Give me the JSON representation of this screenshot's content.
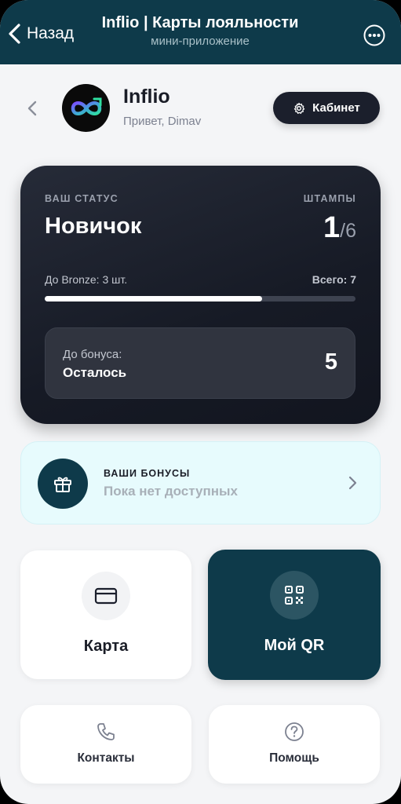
{
  "topbar": {
    "back_label": "Назад",
    "title": "Inflio | Карты лояльности",
    "subtitle": "мини-приложение",
    "more_icon": "more-icon"
  },
  "header": {
    "brand_name": "Inflio",
    "greeting": "Привет, Dimav",
    "cabinet_label": "Кабинет"
  },
  "status_card": {
    "status_label": "ВАШ СТАТУС",
    "status_value": "Новичок",
    "stamps_label": "ШТАМПЫ",
    "stamps_current": "1",
    "stamps_total": "/6",
    "next_level_text": "До Bronze: 3 шт.",
    "total_text": "Всего: 7",
    "progress_fraction": 0.7,
    "bonus_label": "До бонуса:",
    "bonus_remaining_label": "Осталось",
    "bonus_remaining_value": "5"
  },
  "bonuses": {
    "title": "ВАШИ БОНУСЫ",
    "subtitle": "Пока нет доступных"
  },
  "tiles": {
    "card_label": "Карта",
    "qr_label": "Мой QR",
    "contacts_label": "Контакты",
    "help_label": "Помощь"
  },
  "colors": {
    "brand_dark_teal": "#0e3a4a",
    "card_dark": "#1b1f2c",
    "bonus_bg": "#e7fbfd"
  }
}
